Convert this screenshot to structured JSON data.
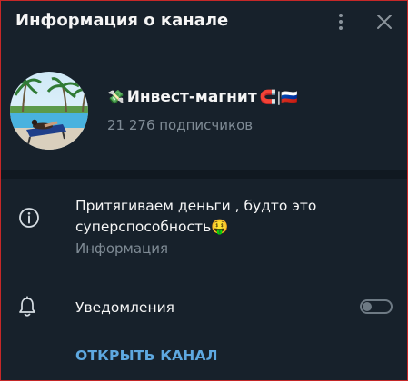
{
  "header": {
    "title": "Информация о канале"
  },
  "channel": {
    "name": "Инвест-магнит",
    "name_emojis_prefix": "💸",
    "name_emojis_suffix": "🧲|🇷🇺",
    "subscribers": "21 276 подписчиков"
  },
  "info": {
    "description": "Притягиваем деньги , будто это суперспособность🤑",
    "label": "Информация"
  },
  "notifications": {
    "label": "Уведомления",
    "enabled": false
  },
  "actions": {
    "open_channel": "ОТКРЫТЬ КАНАЛ"
  },
  "colors": {
    "background": "#17212b",
    "accent": "#5ea8e0",
    "muted_text": "#7f8b95",
    "frame_border": "#c62828"
  },
  "icons": {
    "menu": "kebab-icon",
    "close": "close-icon",
    "info": "info-icon",
    "notifications": "bell-icon"
  }
}
